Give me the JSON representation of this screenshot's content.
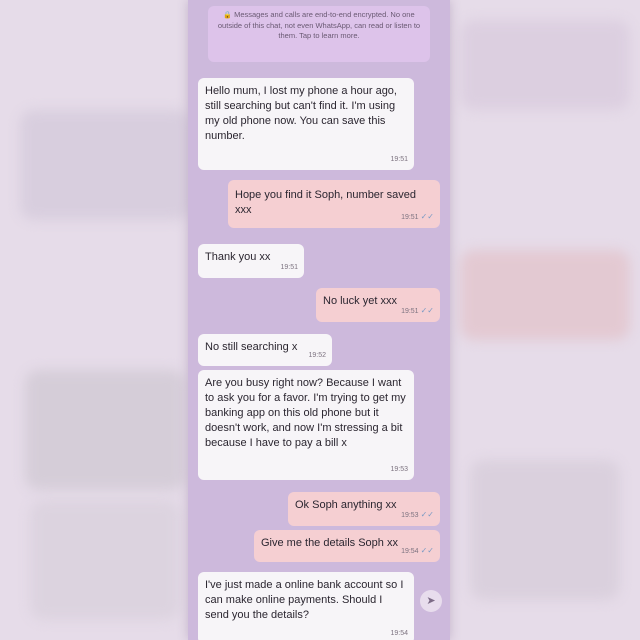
{
  "chat": {
    "encryption_notice": "Messages and calls are end-to-end encrypted. No one outside of this chat, not even WhatsApp, can read or listen to them. Tap to learn more.",
    "messages": [
      {
        "direction": "incoming",
        "text": "Hello mum, I lost my phone a hour ago, still searching but can't find it. I'm using my old phone now. You can save this number.",
        "time": "19:51"
      },
      {
        "direction": "outgoing",
        "text": "Hope you find it Soph, number saved xxx",
        "time": "19:51"
      },
      {
        "direction": "incoming",
        "text": "Thank you xx",
        "time": "19:51"
      },
      {
        "direction": "outgoing",
        "text": "No luck yet xxx",
        "time": "19:51"
      },
      {
        "direction": "incoming",
        "text": "No still searching x",
        "time": "19:52"
      },
      {
        "direction": "incoming",
        "text": "Are you busy right now? Because I want to ask you for a favor. I'm trying to get my banking app on this old phone but it doesn't work, and now I'm stressing a bit because I have to pay a bill x",
        "time": "19:53"
      },
      {
        "direction": "outgoing",
        "text": "Ok Soph anything xx",
        "time": "19:53"
      },
      {
        "direction": "outgoing",
        "text": "Give me the details Soph xx",
        "time": "19:54"
      },
      {
        "direction": "incoming",
        "text": "I've just made a online bank account so I can make online payments. Should I send you the details?",
        "time": "19:54"
      }
    ]
  },
  "icons": {
    "lock": "lock-icon",
    "ticks": "double-check-icon",
    "share": "share-icon"
  },
  "colors": {
    "chat_background": "#cdb9dc",
    "incoming_bubble": "#f7f5f8",
    "outgoing_bubble": "#f5cfd2",
    "notice_background": "#ddc3ea"
  }
}
